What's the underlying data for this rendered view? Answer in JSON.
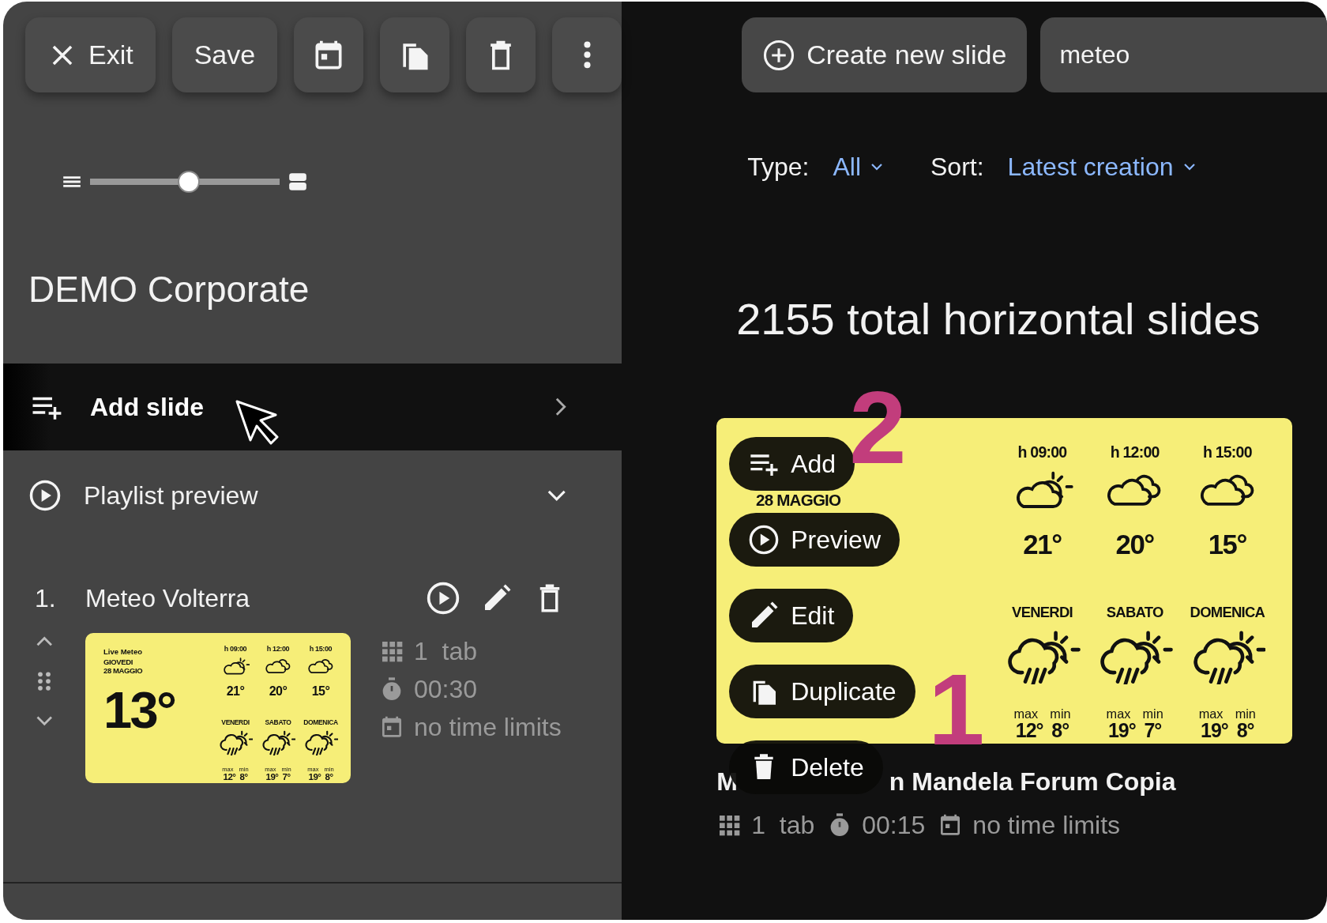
{
  "toolbar": [
    {
      "kind": "exit",
      "label": "Exit"
    },
    {
      "kind": "text",
      "label": "Save"
    },
    {
      "kind": "calendar"
    },
    {
      "kind": "copy"
    },
    {
      "kind": "trash"
    },
    {
      "kind": "more"
    }
  ],
  "zoom_slider": {
    "level": 0.52
  },
  "playlist_title": "DEMO Corporate",
  "add_slide": {
    "label": "Add slide"
  },
  "playlist_preview": {
    "label": "Playlist preview",
    "expanded": false
  },
  "playlist_items": [
    {
      "index": "1.",
      "title": "Meteo Volterra",
      "tabs": "1  tab",
      "duration": "00:30",
      "time_limits": "no time limits",
      "thumbnail": {
        "brand": "Live Meteo",
        "day": "GIOVEDI",
        "date": "28 MAGGIO",
        "now": "13°",
        "hours": [
          {
            "time": "h 09:00",
            "kind": "partly",
            "temp": "21°"
          },
          {
            "time": "h 12:00",
            "kind": "cloudy",
            "temp": "20°"
          },
          {
            "time": "h 15:00",
            "kind": "cloudy",
            "temp": "15°"
          }
        ],
        "days": [
          {
            "day": "VENERDI",
            "max_label": "max",
            "min_label": "min",
            "max": "12°",
            "min": "8°"
          },
          {
            "day": "SABATO",
            "max_label": "max",
            "min_label": "min",
            "max": "19°",
            "min": "7°"
          },
          {
            "day": "DOMENICA",
            "max_label": "max",
            "min_label": "min",
            "max": "19°",
            "min": "8°"
          }
        ]
      }
    }
  ],
  "create_button": {
    "label": "Create new slide"
  },
  "search": {
    "value": "meteo"
  },
  "filters": [
    {
      "label": "Type:",
      "value": "All"
    },
    {
      "label": "Sort:",
      "value": "Latest creation"
    }
  ],
  "total": "2155 total horizontal slides",
  "slides": [
    {
      "title_start": "M",
      "title_end": "n Mandela Forum Copia",
      "tabs": "1  tab",
      "duration": "00:15",
      "time_limits": "no time limits",
      "thumbnail": {
        "date": "28 MAGGIO",
        "hours": [
          {
            "time": "h 09:00",
            "kind": "partly",
            "temp": "21°"
          },
          {
            "time": "h 12:00",
            "kind": "cloudy",
            "temp": "20°"
          },
          {
            "time": "h 15:00",
            "kind": "cloudy",
            "temp": "15°"
          }
        ],
        "days": [
          {
            "day": "VENERDI",
            "max_label": "max",
            "min_label": "min",
            "max": "12°",
            "min": "8°"
          },
          {
            "day": "SABATO",
            "max_label": "max",
            "min_label": "min",
            "max": "19°",
            "min": "7°"
          },
          {
            "day": "DOMENICA",
            "max_label": "max",
            "min_label": "min",
            "max": "19°",
            "min": "8°"
          }
        ]
      },
      "actions": [
        {
          "kind": "add",
          "label": "Add"
        },
        {
          "kind": "preview",
          "label": "Preview"
        },
        {
          "kind": "edit",
          "label": "Edit"
        },
        {
          "kind": "duplicate",
          "label": "Duplicate"
        },
        {
          "kind": "delete",
          "label": "Delete"
        }
      ]
    }
  ],
  "annotations": [
    {
      "label": "2"
    },
    {
      "label": "1"
    }
  ]
}
